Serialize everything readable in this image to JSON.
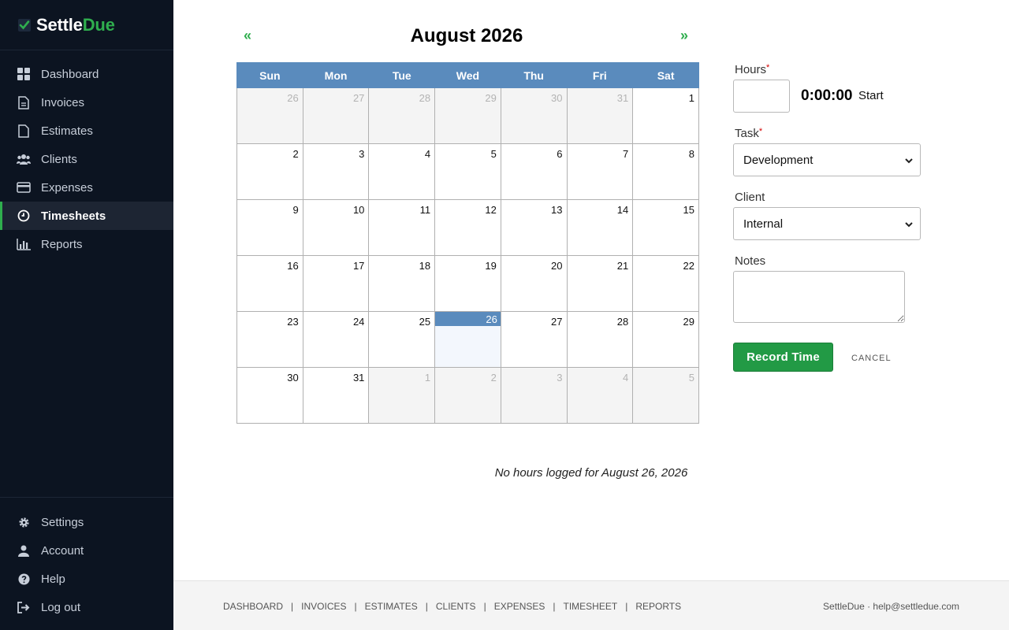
{
  "brand": {
    "name_a": "Settle",
    "name_b": "Due"
  },
  "sidebar": {
    "items": [
      {
        "label": "Dashboard",
        "icon": "dashboard-icon"
      },
      {
        "label": "Invoices",
        "icon": "invoice-icon"
      },
      {
        "label": "Estimates",
        "icon": "estimate-icon"
      },
      {
        "label": "Clients",
        "icon": "clients-icon"
      },
      {
        "label": "Expenses",
        "icon": "credit-card-icon"
      },
      {
        "label": "Timesheets",
        "icon": "clock-icon",
        "active": true
      },
      {
        "label": "Reports",
        "icon": "bar-chart-icon"
      }
    ],
    "bottom_items": [
      {
        "label": "Settings",
        "icon": "gear-icon"
      },
      {
        "label": "Account",
        "icon": "user-icon"
      },
      {
        "label": "Help",
        "icon": "help-icon"
      },
      {
        "label": "Log out",
        "icon": "logout-icon"
      }
    ]
  },
  "calendar": {
    "title": "August 2026",
    "prev": "«",
    "next": "»",
    "weekdays": [
      "Sun",
      "Mon",
      "Tue",
      "Wed",
      "Thu",
      "Fri",
      "Sat"
    ],
    "weeks": [
      [
        "26",
        "27",
        "28",
        "29",
        "30",
        "31",
        "1"
      ],
      [
        "2",
        "3",
        "4",
        "5",
        "6",
        "7",
        "8"
      ],
      [
        "9",
        "10",
        "11",
        "12",
        "13",
        "14",
        "15"
      ],
      [
        "16",
        "17",
        "18",
        "19",
        "20",
        "21",
        "22"
      ],
      [
        "23",
        "24",
        "25",
        "26",
        "27",
        "28",
        "29"
      ],
      [
        "30",
        "31",
        "1",
        "2",
        "3",
        "4",
        "5"
      ]
    ],
    "selected_day": "26",
    "empty_message": "No hours logged for August 26, 2026"
  },
  "form": {
    "hours_label": "Hours",
    "hours_value": "",
    "timer": "0:00:00",
    "start_label": "Start",
    "task_label": "Task",
    "task_value": "Development",
    "client_label": "Client",
    "client_value": "Internal",
    "notes_label": "Notes",
    "notes_value": "",
    "required_mark": "*",
    "record_label": "Record Time",
    "cancel_label": "CANCEL"
  },
  "footer": {
    "links": [
      "DASHBOARD",
      "INVOICES",
      "ESTIMATES",
      "CLIENTS",
      "EXPENSES",
      "TIMESHEET",
      "REPORTS"
    ],
    "separator": "|",
    "contact": "SettleDue · help@settledue.com"
  },
  "colors": {
    "accent": "#2fae4e",
    "sidebar_bg": "#0c1421",
    "calendar_header": "#5a8bbd",
    "record_button": "#229a45"
  }
}
